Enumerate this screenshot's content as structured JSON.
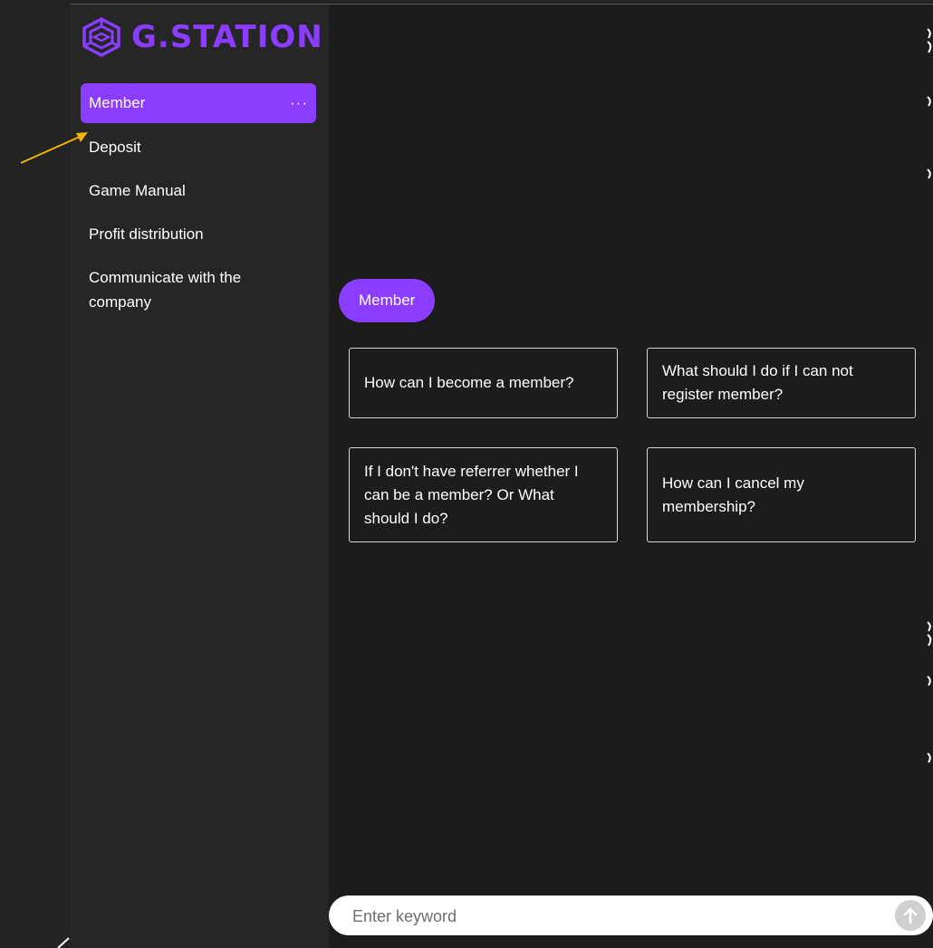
{
  "brand": {
    "name": "G.STATION",
    "logo_icon": "hexagon-gamepad-logo-icon",
    "color": "#8b3dff"
  },
  "sidebar": {
    "items": [
      {
        "label": "Member",
        "active": true,
        "more_label": "···"
      },
      {
        "label": "Deposit"
      },
      {
        "label": "Game Manual"
      },
      {
        "label": "Profit distribution"
      },
      {
        "label": "Communicate with the company"
      }
    ]
  },
  "chat": {
    "chip_label": "Member",
    "questions": [
      "How can I become a member?",
      "What should I do if I can not register member?",
      "If I don't have referrer whether I can be a member? Or What should I do?",
      "How can I cancel my membership?"
    ]
  },
  "search": {
    "placeholder": "Enter keyword",
    "send_icon": "arrow-up-icon"
  },
  "colors": {
    "accent": "#8b3dff",
    "sidebar_bg": "#262626",
    "main_bg": "#1c1c1c",
    "annotation": "#f5b400"
  }
}
